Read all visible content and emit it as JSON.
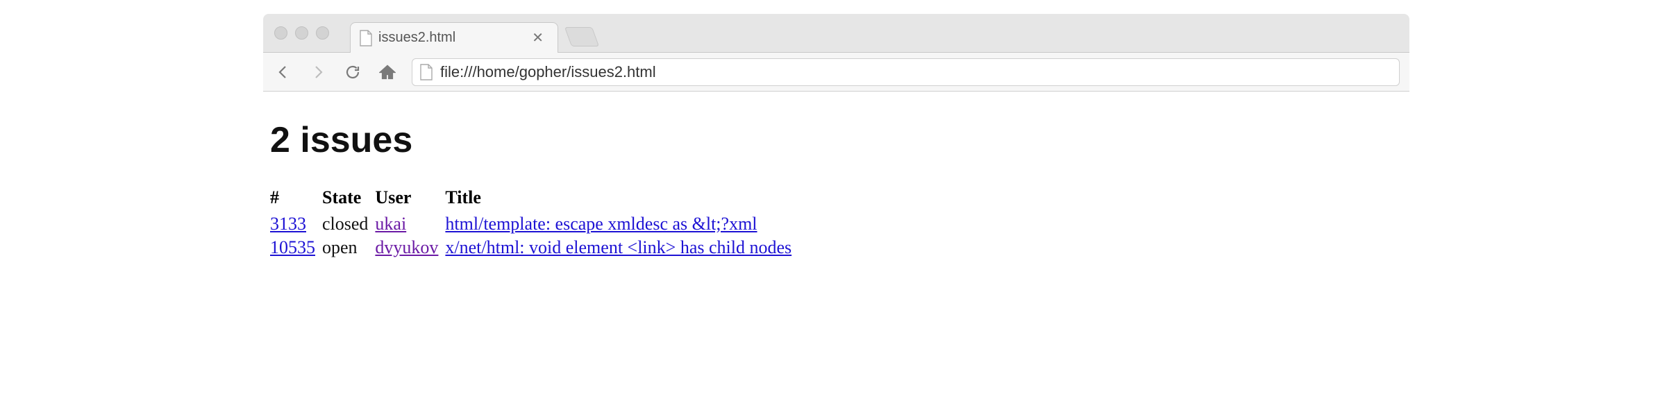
{
  "browser": {
    "tab_title": "issues2.html",
    "address": "file:///home/gopher/issues2.html"
  },
  "page": {
    "heading": "2 issues",
    "columns": {
      "num": "#",
      "state": "State",
      "user": "User",
      "title": "Title"
    },
    "rows": [
      {
        "num": "3133",
        "state": "closed",
        "user": "ukai",
        "user_visited": true,
        "title": "html/template: escape xmldesc as &lt;?xml"
      },
      {
        "num": "10535",
        "state": "open",
        "user": "dvyukov",
        "user_visited": true,
        "title": "x/net/html: void element <link> has child nodes"
      }
    ]
  }
}
